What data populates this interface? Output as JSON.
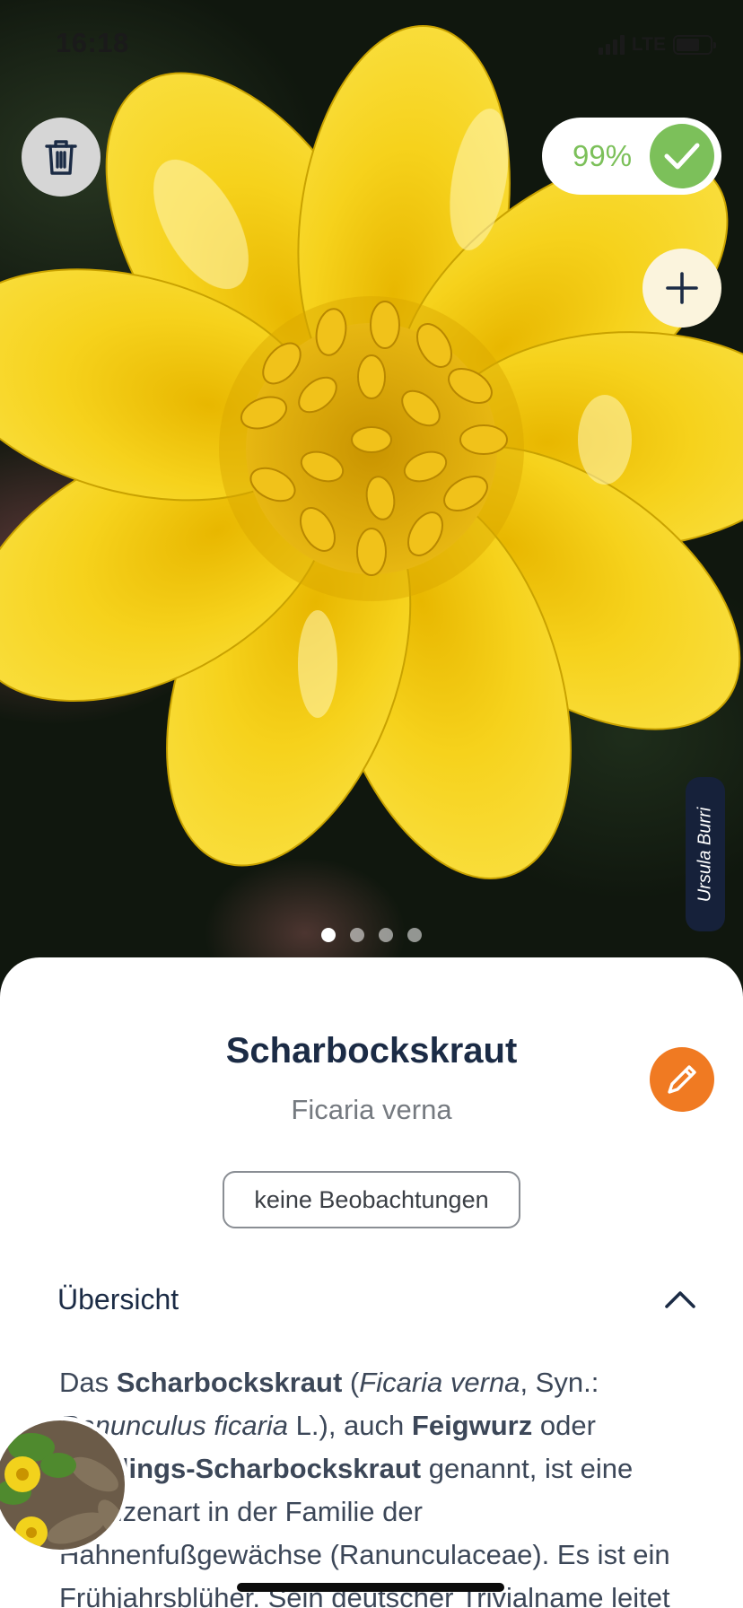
{
  "status_bar": {
    "time": "16:18",
    "network": "LTE"
  },
  "photo": {
    "credit": "Ursula Burri",
    "confidence": "99%",
    "slide_count": 4,
    "active_slide": 0
  },
  "icons": {
    "trash": "trash-icon",
    "check": "check-icon",
    "plus": "plus-icon",
    "edit": "pencil-icon",
    "collapse": "chevron-up-icon"
  },
  "species": {
    "common_name": "Scharbockskraut",
    "latin_name": "Ficaria verna",
    "observations": "keine Beobachtungen"
  },
  "overview": {
    "heading": "Übersicht",
    "p1": "Das ",
    "b1": "Scharbockskraut",
    "p2": " (",
    "i1": "Ficaria verna",
    "p3": ", Syn.: ",
    "i2": "Ranunculus ficaria",
    "p4": " L.), auch ",
    "b2": "Feigwurz",
    "p5": " oder ",
    "b3": "Frühlings-Scharbockskraut",
    "p6": " genannt, ist eine Pflanzenart in der Familie der Hahnenfußgewächse (Ranunculaceae). Es ist ein Frühjahrsblüher. Sein deutscher Trivialname leitet sich"
  },
  "colors": {
    "accent_green": "#7cc05a",
    "edit_orange": "#f07a22",
    "title_navy": "#1b2b45",
    "credit_bg": "#16213a"
  }
}
